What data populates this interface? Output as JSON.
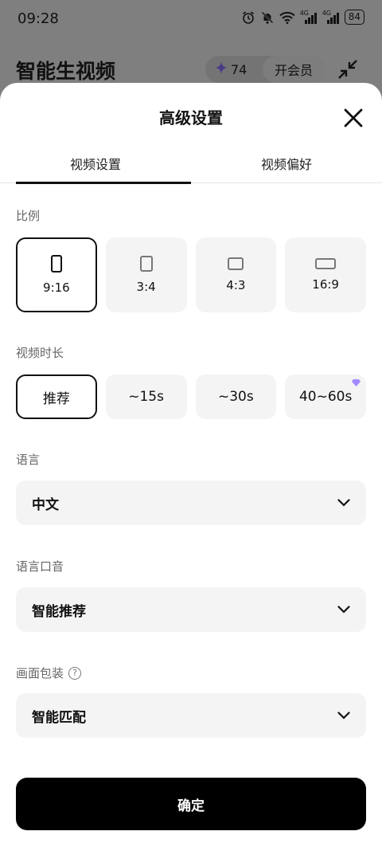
{
  "status_bar": {
    "time": "09:28",
    "network_1": "4G",
    "network_2": "4G",
    "battery": "84"
  },
  "background_app": {
    "title": "智能生视频",
    "credits": "74",
    "member_button": "开会员",
    "icons": [
      "sparkle-icon",
      "collapse-icon"
    ]
  },
  "sheet": {
    "title": "高级设置",
    "tabs": [
      {
        "label": "视频设置",
        "active": true
      },
      {
        "label": "视频偏好",
        "active": false
      }
    ],
    "ratio": {
      "label": "比例",
      "options": [
        {
          "label": "9:16",
          "selected": true
        },
        {
          "label": "3:4",
          "selected": false
        },
        {
          "label": "4:3",
          "selected": false
        },
        {
          "label": "16:9",
          "selected": false
        }
      ]
    },
    "duration": {
      "label": "视频时长",
      "options": [
        {
          "label": "推荐",
          "selected": true
        },
        {
          "label": "~15s",
          "selected": false
        },
        {
          "label": "~30s",
          "selected": false
        },
        {
          "label": "40~60s",
          "selected": false,
          "premium": true
        }
      ]
    },
    "language": {
      "label": "语言",
      "value": "中文"
    },
    "accent": {
      "label": "语言口音",
      "value": "智能推荐"
    },
    "packaging": {
      "label": "画面包装",
      "value": "智能匹配",
      "help_icon": "?"
    },
    "confirm_label": "确定"
  },
  "colors": {
    "accent": "#000000",
    "premium": "#a48bff",
    "overlay": "#7f7f7f"
  }
}
